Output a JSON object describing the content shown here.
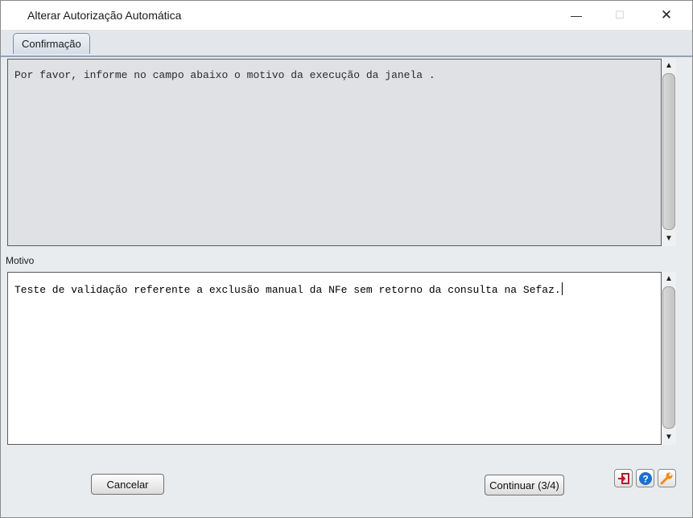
{
  "window": {
    "title": "Alterar Autorização Automática",
    "controls": {
      "minimize": "—",
      "maximize": "☐",
      "close": "✕"
    }
  },
  "tabs": [
    {
      "label": "Confirmação",
      "active": true
    }
  ],
  "info_panel": {
    "text": "Por favor, informe no campo abaixo o motivo da execução da janela ."
  },
  "reason_field": {
    "label": "Motivo",
    "value": "Teste de validação referente a exclusão manual da NFe sem retorno da consulta na Sefaz."
  },
  "scroll_arrows": {
    "up": "▲",
    "down": "▼"
  },
  "buttons": {
    "cancel": "Cancelar",
    "continue": "Continuar (3/4)"
  },
  "toolbar_icons": [
    "exit-icon",
    "help-icon",
    "wrench-icon"
  ],
  "colors": {
    "exit": "#b3202a",
    "help": "#1f6fd1",
    "wrench": "#f08a1c"
  }
}
